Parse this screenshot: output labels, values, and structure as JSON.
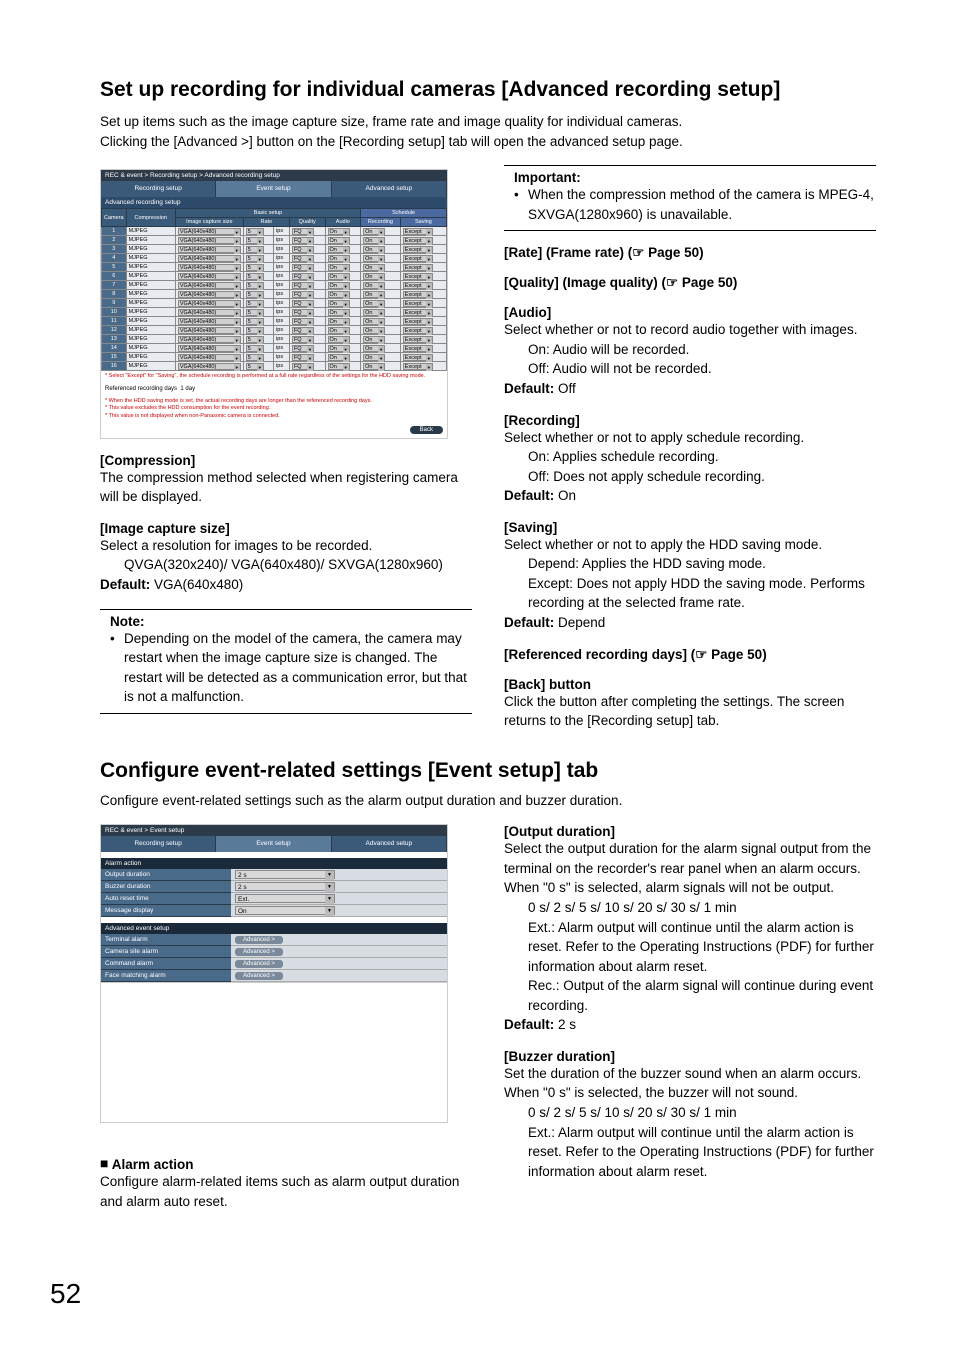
{
  "page_number": "52",
  "title1": "Set up recording for individual cameras [Advanced recording setup]",
  "intro1a": "Set up items such as the image capture size, frame rate and image quality for individual cameras.",
  "intro1b": "Clicking the [Advanced >] button on the [Recording setup] tab will open the advanced setup page.",
  "ss1": {
    "crumb": "REC & event > Recording setup > Advanced recording setup",
    "tabs": [
      "Recording setup",
      "Event setup",
      "Advanced setup"
    ],
    "subbar": "Advanced recording setup",
    "header_groups": {
      "basic": "Basic setup",
      "schedule": "Schedule"
    },
    "cols": [
      "Camera",
      "Compression",
      "Image capture size",
      "Rate",
      "",
      "Quality",
      "Audio",
      "Recording",
      "Saving"
    ],
    "row": {
      "compression": "MJPEG",
      "size": "VGA(640x480)",
      "rate": "5",
      "unit": "ips",
      "quality": "FQ",
      "audio": "On",
      "recording": "On",
      "saving": "Except"
    },
    "foot1": "* Select \"Except\" for \"Saving\", the schedule recording is performed at a full rate regardless of the settings for the HDD saving mode.",
    "refdays_label": "Referenced recording days",
    "refdays_val": "1 day",
    "foot2": "* When the HDD saving mode is set, the actual recording days are longer than the referenced recording days.",
    "foot3": "* This value excludes the HDD consumption for the event recording.",
    "foot4": "* This value is not displayed when non-Panasonic camera is connected.",
    "back": "Back"
  },
  "left": {
    "compression_h": "[Compression]",
    "compression_b": "The compression method selected when registering camera will be displayed.",
    "imgsize_h": "[Image capture size]",
    "imgsize_b1": "Select a resolution for images to be recorded.",
    "imgsize_b2": "QVGA(320x240)/ VGA(640x480)/ SXVGA(1280x960)",
    "imgsize_def_l": "Default: ",
    "imgsize_def_v": "VGA(640x480)",
    "note_t": "Note:",
    "note_b": "Depending on the model of the camera, the camera may restart when the image capture size is changed. The restart will be detected as a communication error, but that is not a malfunction."
  },
  "right": {
    "imp_t": "Important:",
    "imp_b": "When the compression method of the camera is MPEG-4, SXVGA(1280x960) is unavailable.",
    "rate_h": "[Rate] (Frame rate) (☞ Page 50)",
    "quality_h": "[Quality] (Image quality) (☞ Page 50)",
    "audio_h": "[Audio]",
    "audio_b1": "Select whether or not to record audio together with images.",
    "audio_on": "On: Audio will be recorded.",
    "audio_off": "Off: Audio will not be recorded.",
    "audio_def_l": "Default: ",
    "audio_def_v": "Off",
    "rec_h": "[Recording]",
    "rec_b1": "Select whether or not to apply schedule recording.",
    "rec_on": "On: Applies schedule recording.",
    "rec_off": "Off: Does not apply schedule recording.",
    "rec_def_l": "Default: ",
    "rec_def_v": "On",
    "sav_h": "[Saving]",
    "sav_b1": "Select whether or not to apply the HDD saving mode.",
    "sav_dep": "Depend: Applies the HDD saving mode.",
    "sav_exc": "Except: Does not apply HDD the saving mode. Performs recording at the selected frame rate.",
    "sav_def_l": "Default: ",
    "sav_def_v": "Depend",
    "refd_h": "[Referenced recording days] (☞ Page 50)",
    "back_h": "[Back] button",
    "back_b": "Click the button after completing the settings. The screen returns to the [Recording setup] tab."
  },
  "title2": "Configure event-related settings [Event setup] tab",
  "intro2": "Configure event-related settings such as the alarm output duration and buzzer duration.",
  "ss2": {
    "crumb": "REC & event > Event setup",
    "tabs": [
      "Recording setup",
      "Event setup",
      "Advanced setup"
    ],
    "g1": "Alarm action",
    "rows1": [
      {
        "l": "Output duration",
        "v": "2 s"
      },
      {
        "l": "Buzzer duration",
        "v": "2 s"
      },
      {
        "l": "Auto reset time",
        "v": "Ext."
      },
      {
        "l": "Message display",
        "v": "On"
      }
    ],
    "g2": "Advanced event setup",
    "rows2": [
      {
        "l": "Terminal alarm",
        "v": "Advanced"
      },
      {
        "l": "Camera site alarm",
        "v": "Advanced"
      },
      {
        "l": "Command alarm",
        "v": "Advanced"
      },
      {
        "l": "Face matching alarm",
        "v": "Advanced"
      }
    ]
  },
  "left2": {
    "alarm_h": "Alarm action",
    "alarm_b": "Configure alarm-related items such as alarm output duration and alarm auto reset."
  },
  "right2": {
    "od_h": "[Output duration]",
    "od_b1": "Select the output duration for the alarm signal output from the terminal on the recorder's rear panel when an alarm occurs. When \"0 s\" is selected, alarm signals will not be output.",
    "od_opts": "0 s/ 2 s/ 5 s/ 10 s/ 20 s/ 30 s/ 1 min",
    "od_ext": "Ext.: Alarm output will continue until the alarm action is reset. Refer to the Operating Instructions (PDF) for further information about alarm reset.",
    "od_rec": "Rec.: Output of the alarm signal will continue during event recording.",
    "od_def_l": "Default: ",
    "od_def_v": "2 s",
    "bd_h": "[Buzzer duration]",
    "bd_b1": "Set the duration of the buzzer sound when an alarm occurs. When \"0 s\" is selected, the buzzer will not sound.",
    "bd_opts": "0 s/ 2 s/ 5 s/ 10 s/ 20 s/ 30 s/ 1 min",
    "bd_ext": "Ext.: Alarm output will continue until the alarm action is reset. Refer to the Operating Instructions (PDF) for further information about alarm reset."
  }
}
